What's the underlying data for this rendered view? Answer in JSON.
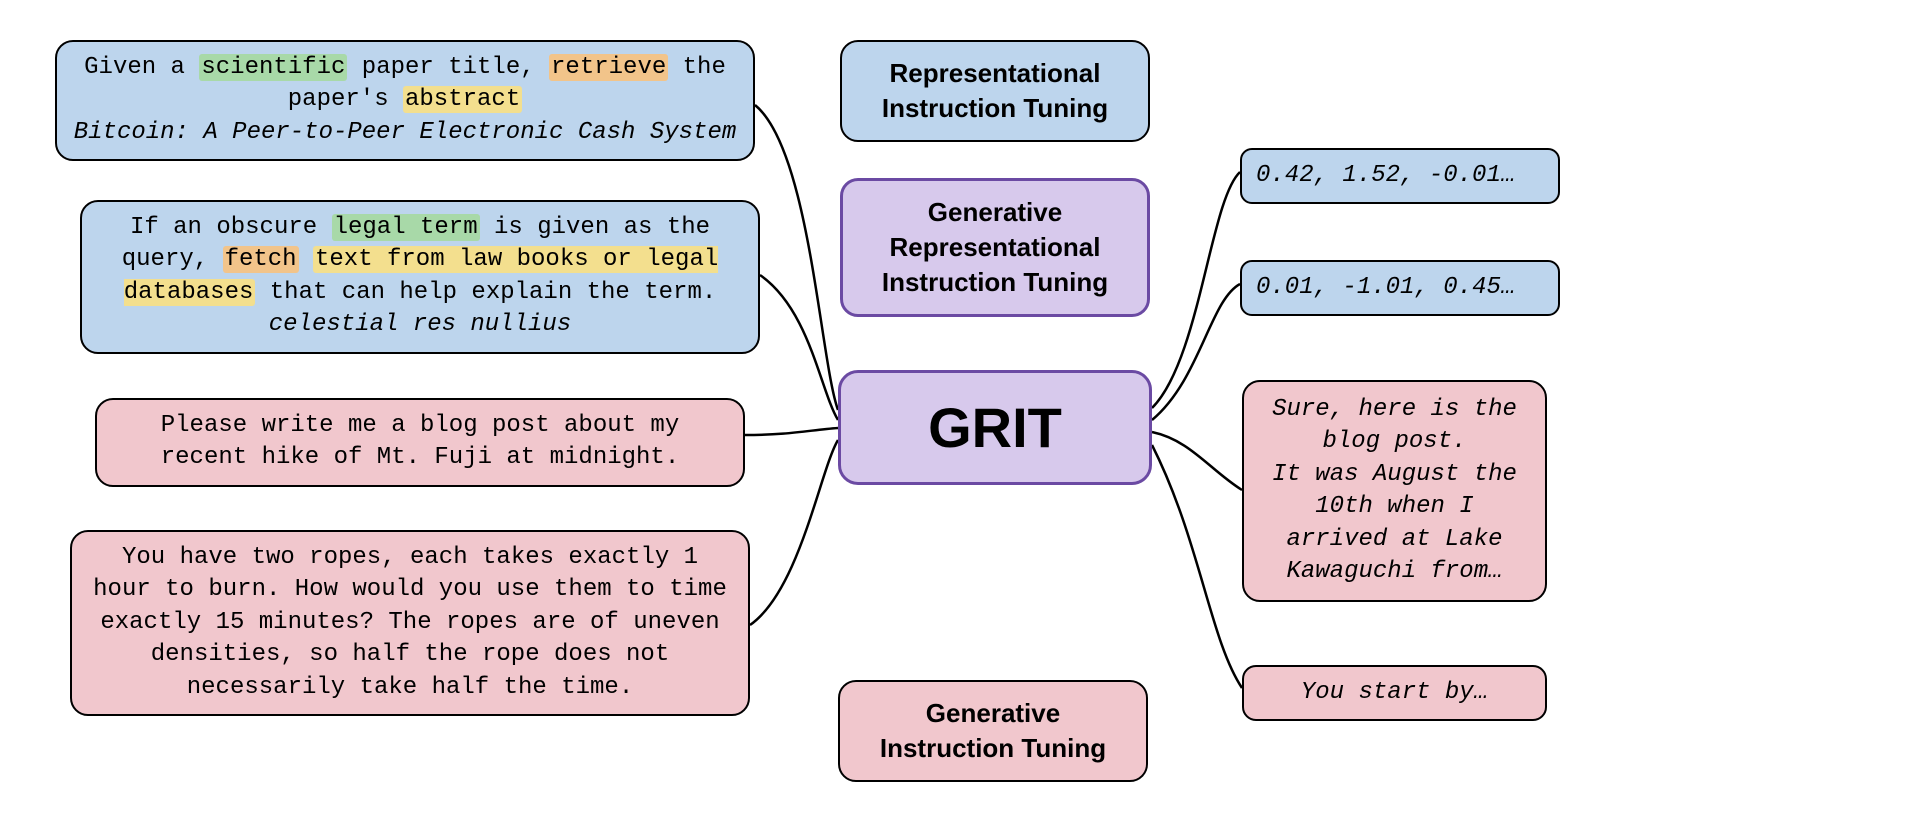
{
  "inputs": {
    "in1": {
      "line1_parts": [
        "Given a ",
        "scientific",
        " paper title, ",
        "retrieve",
        " the paper's ",
        "abstract"
      ],
      "line1_classes": [
        "",
        "hl-green",
        "",
        "hl-orange",
        "",
        "hl-yellow"
      ],
      "line2": "Bitcoin: A Peer-to-Peer Electronic Cash System"
    },
    "in2": {
      "parts": [
        "If an obscure ",
        "legal term",
        " is given as the query, ",
        "fetch",
        " ",
        "text from law books or legal databases",
        " that can help explain the term."
      ],
      "classes": [
        "",
        "hl-green",
        "",
        "hl-orange",
        "",
        "hl-yellow",
        ""
      ],
      "example": "celestial res nullius"
    },
    "in3": "Please write me a blog post about my recent hike of Mt. Fuji at midnight.",
    "in4": "You have two ropes, each takes exactly 1 hour to burn. How would you use them to time exactly 15 minutes? The ropes are of uneven densities, so half the rope does not necessarily take half the time."
  },
  "center": {
    "top_label": "Representational Instruction Tuning",
    "grit_desc": "Generative Representational Instruction Tuning",
    "grit": "GRIT",
    "bot_label": "Generative Instruction Tuning"
  },
  "outputs": {
    "out1": "0.42, 1.52, -0.01…",
    "out2": "0.01, -1.01, 0.45…",
    "out3": "Sure, here is the blog post.\nIt was August the 10th when I arrived at Lake Kawaguchi from…",
    "out4": "You start by…"
  },
  "colors": {
    "blue": "#bdd5ed",
    "pink": "#f1c7cd",
    "purple": "#d7c9ec",
    "green_hl": "#a8d9a8",
    "orange_hl": "#f2c48a",
    "yellow_hl": "#f3df8e"
  }
}
